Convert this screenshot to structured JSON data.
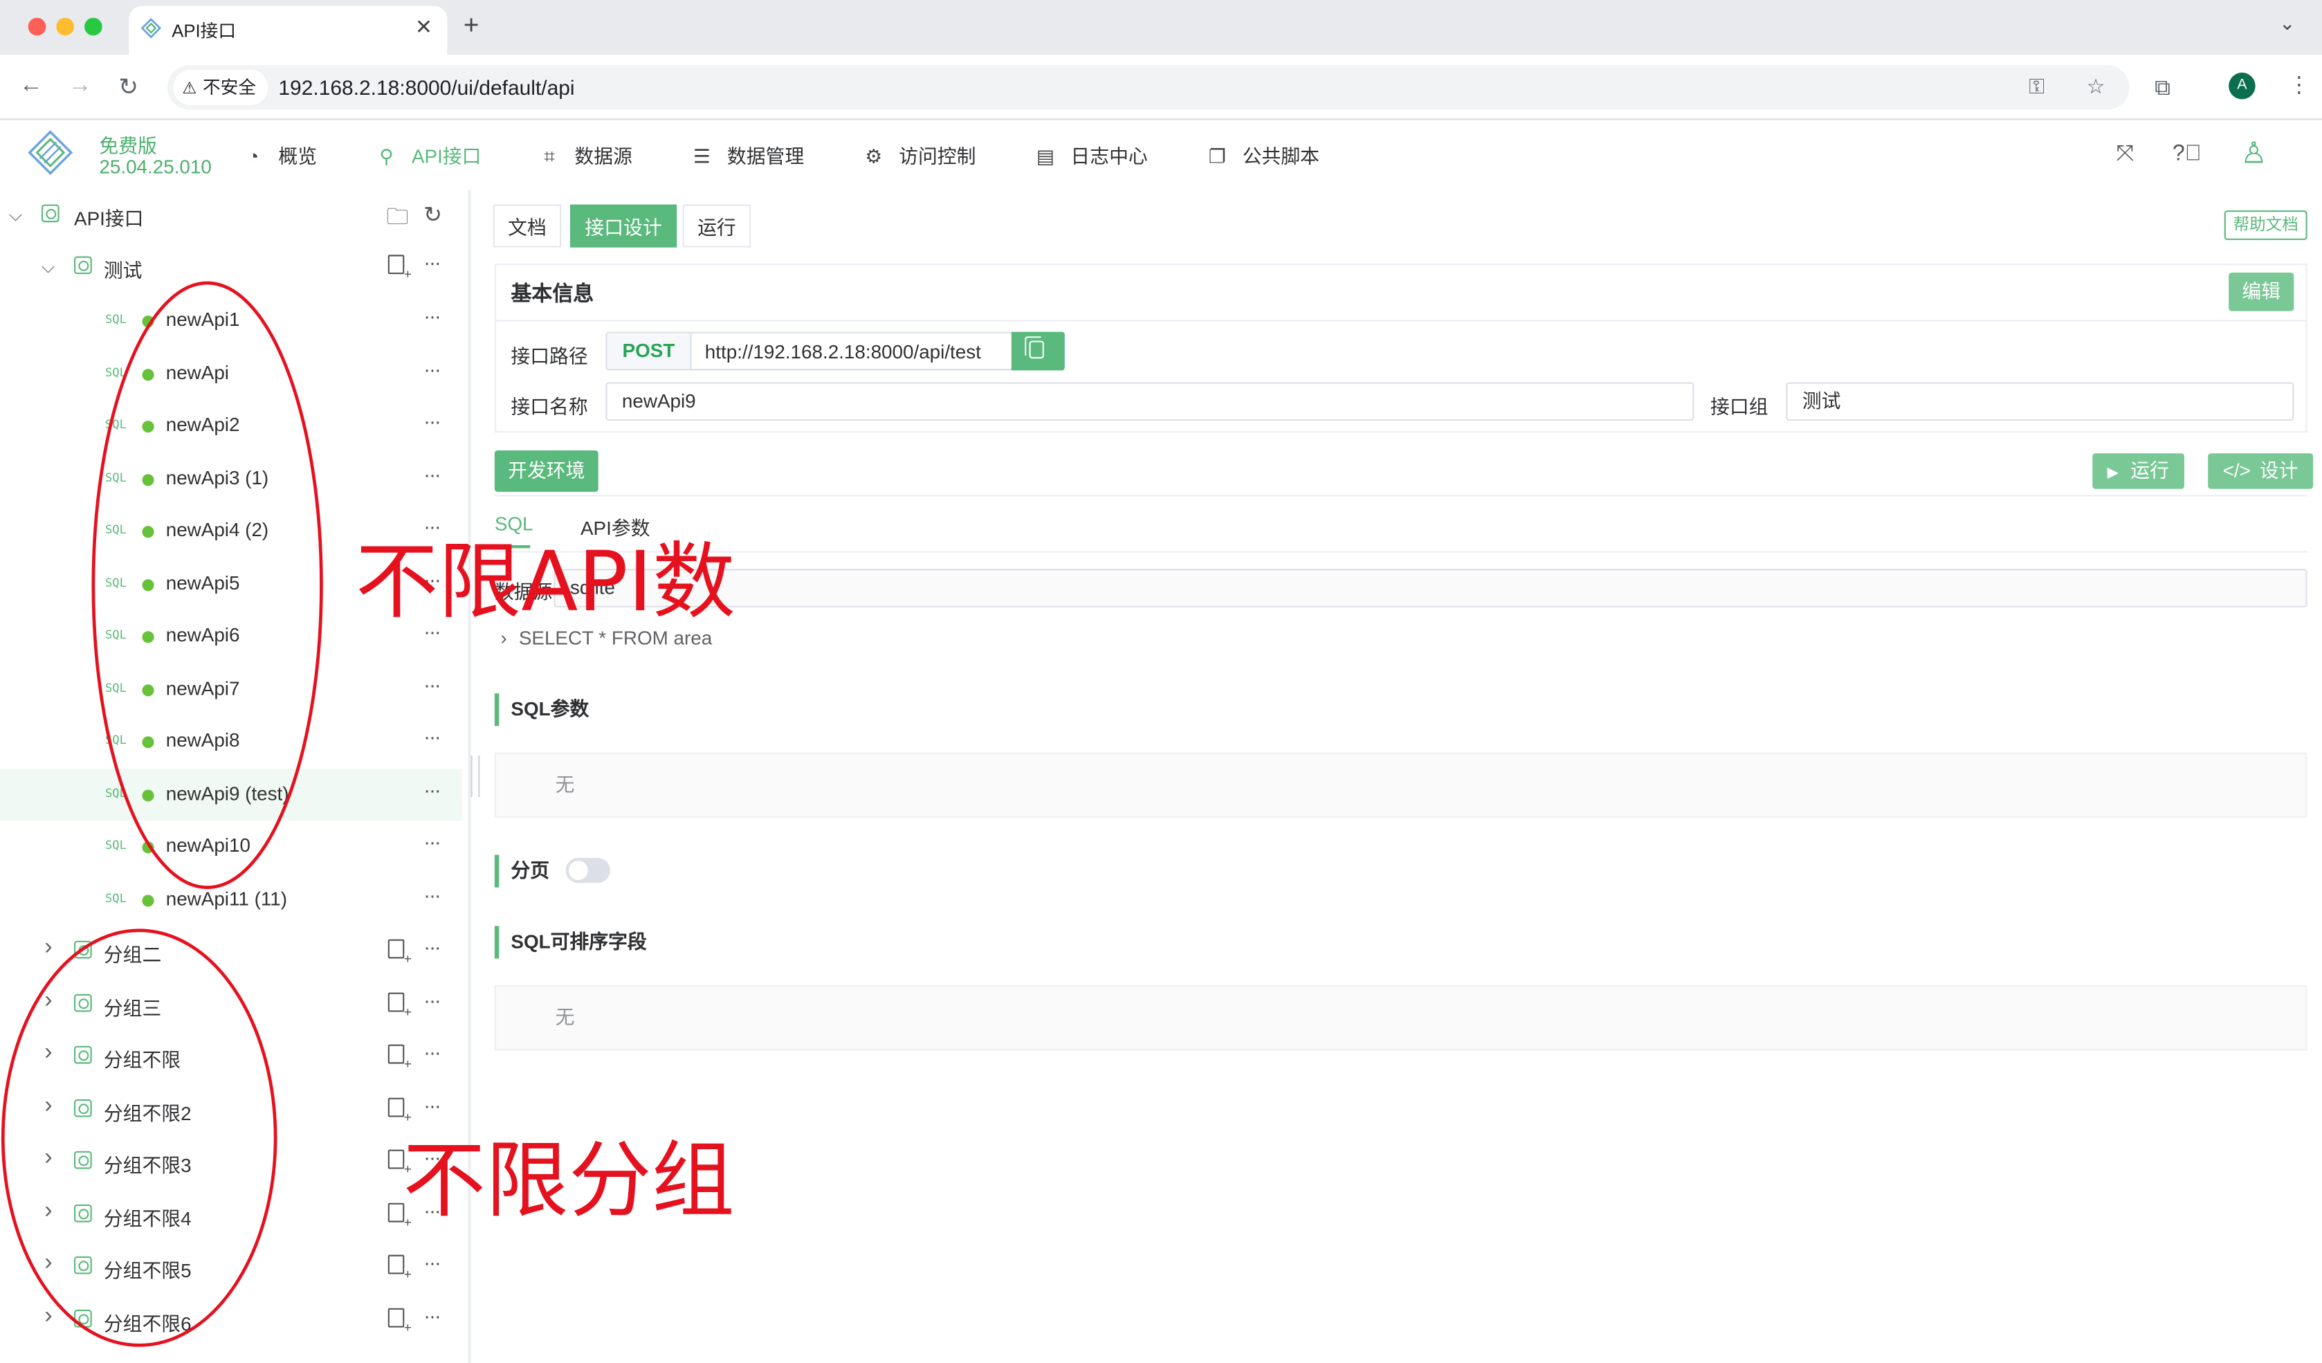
{
  "browser": {
    "tab_title": "API接口",
    "url": "192.168.2.18:8000/ui/default/api",
    "insecure_label": "不安全",
    "profile_initial": "A"
  },
  "header": {
    "edition": "免费版",
    "version": "25.04.25.010",
    "menus": [
      {
        "label": "概览",
        "icon": "dashboard-icon"
      },
      {
        "label": "API接口",
        "icon": "api-link-icon"
      },
      {
        "label": "数据源",
        "icon": "datasource-icon"
      },
      {
        "label": "数据管理",
        "icon": "data-table-icon"
      },
      {
        "label": "访问控制",
        "icon": "gear-icon"
      },
      {
        "label": "日志中心",
        "icon": "log-icon"
      },
      {
        "label": "公共脚本",
        "icon": "script-icon"
      }
    ],
    "active_menu": "API接口"
  },
  "sidebar": {
    "root": "API接口",
    "group_open": "测试",
    "sql_tag": "SQL",
    "apis": [
      "newApi1",
      "newApi",
      "newApi2",
      "newApi3 (1)",
      "newApi4 (2)",
      "newApi5",
      "newApi6",
      "newApi7",
      "newApi8",
      "newApi9 (test)",
      "newApi10",
      "newApi11 (11)"
    ],
    "selected_api": "newApi9 (test)",
    "groups": [
      "分组二",
      "分组三",
      "分组不限",
      "分组不限2",
      "分组不限3",
      "分组不限4",
      "分组不限5",
      "分组不限6"
    ]
  },
  "main": {
    "tabs": [
      "文档",
      "接口设计",
      "运行"
    ],
    "active_tab": "接口设计",
    "help_doc": "帮助文档",
    "basic_info": {
      "title": "基本信息",
      "edit": "编辑",
      "path_label": "接口路径",
      "method": "POST",
      "path_url": "http://192.168.2.18:8000/api/test",
      "name_label": "接口名称",
      "name_value": "newApi9",
      "group_label": "接口组",
      "group_value": "测试"
    },
    "env_button": "开发环境",
    "run_button": "运行",
    "design_button": "设计",
    "sub_tabs": [
      "SQL",
      "API参数"
    ],
    "datasource_label": "数据源",
    "datasource_value": "sqlite",
    "sql_text": "SELECT * FROM area",
    "sql_params_title": "SQL参数",
    "sql_params_empty": "无",
    "paging_label": "分页",
    "paging_enabled": false,
    "sortable_title": "SQL可排序字段",
    "sortable_empty": "无"
  },
  "annotations": {
    "api_unlimited": "不限API数",
    "group_unlimited": "不限分组",
    "color": "#e6111e"
  }
}
